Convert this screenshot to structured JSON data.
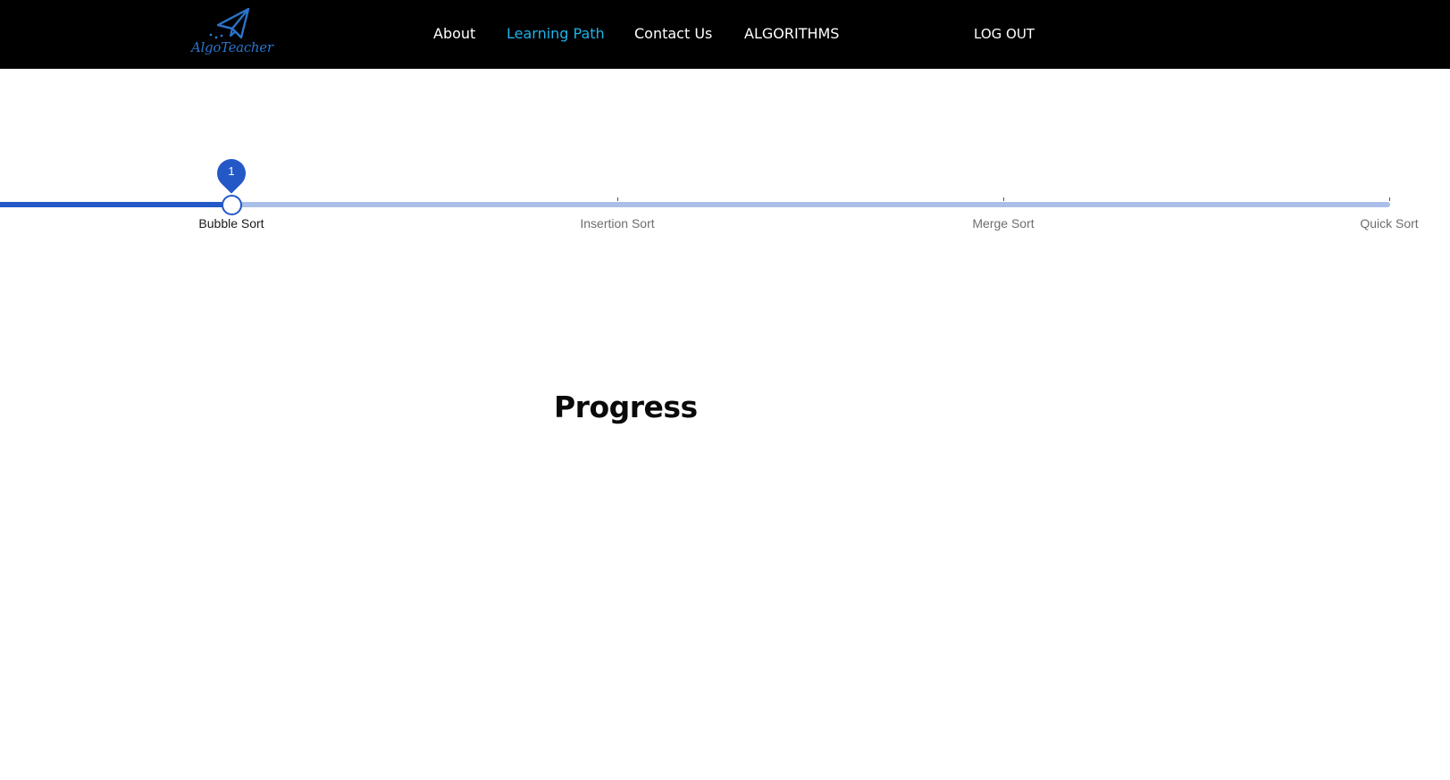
{
  "brand": {
    "name": "AlgoTeacher",
    "color": "#2a74c9"
  },
  "nav": {
    "items": [
      {
        "label": "About",
        "active": false
      },
      {
        "label": "Learning Path",
        "active": true
      },
      {
        "label": "Contact Us",
        "active": false
      },
      {
        "label": "ALGORITHMS",
        "active": false
      }
    ],
    "logout_label": "LOG OUT",
    "active_color": "#1eb3e8"
  },
  "learning_path": {
    "current_value": "1",
    "marks": [
      {
        "label": "Bubble Sort",
        "active": true
      },
      {
        "label": "Insertion Sort",
        "active": false
      },
      {
        "label": "Merge Sort",
        "active": false
      },
      {
        "label": "Quick Sort",
        "active": false
      }
    ],
    "progress_fraction": 0.0,
    "accent_color": "#2458c7",
    "rail_color": "#a9bfe8"
  },
  "progress": {
    "heading": "Progress"
  }
}
